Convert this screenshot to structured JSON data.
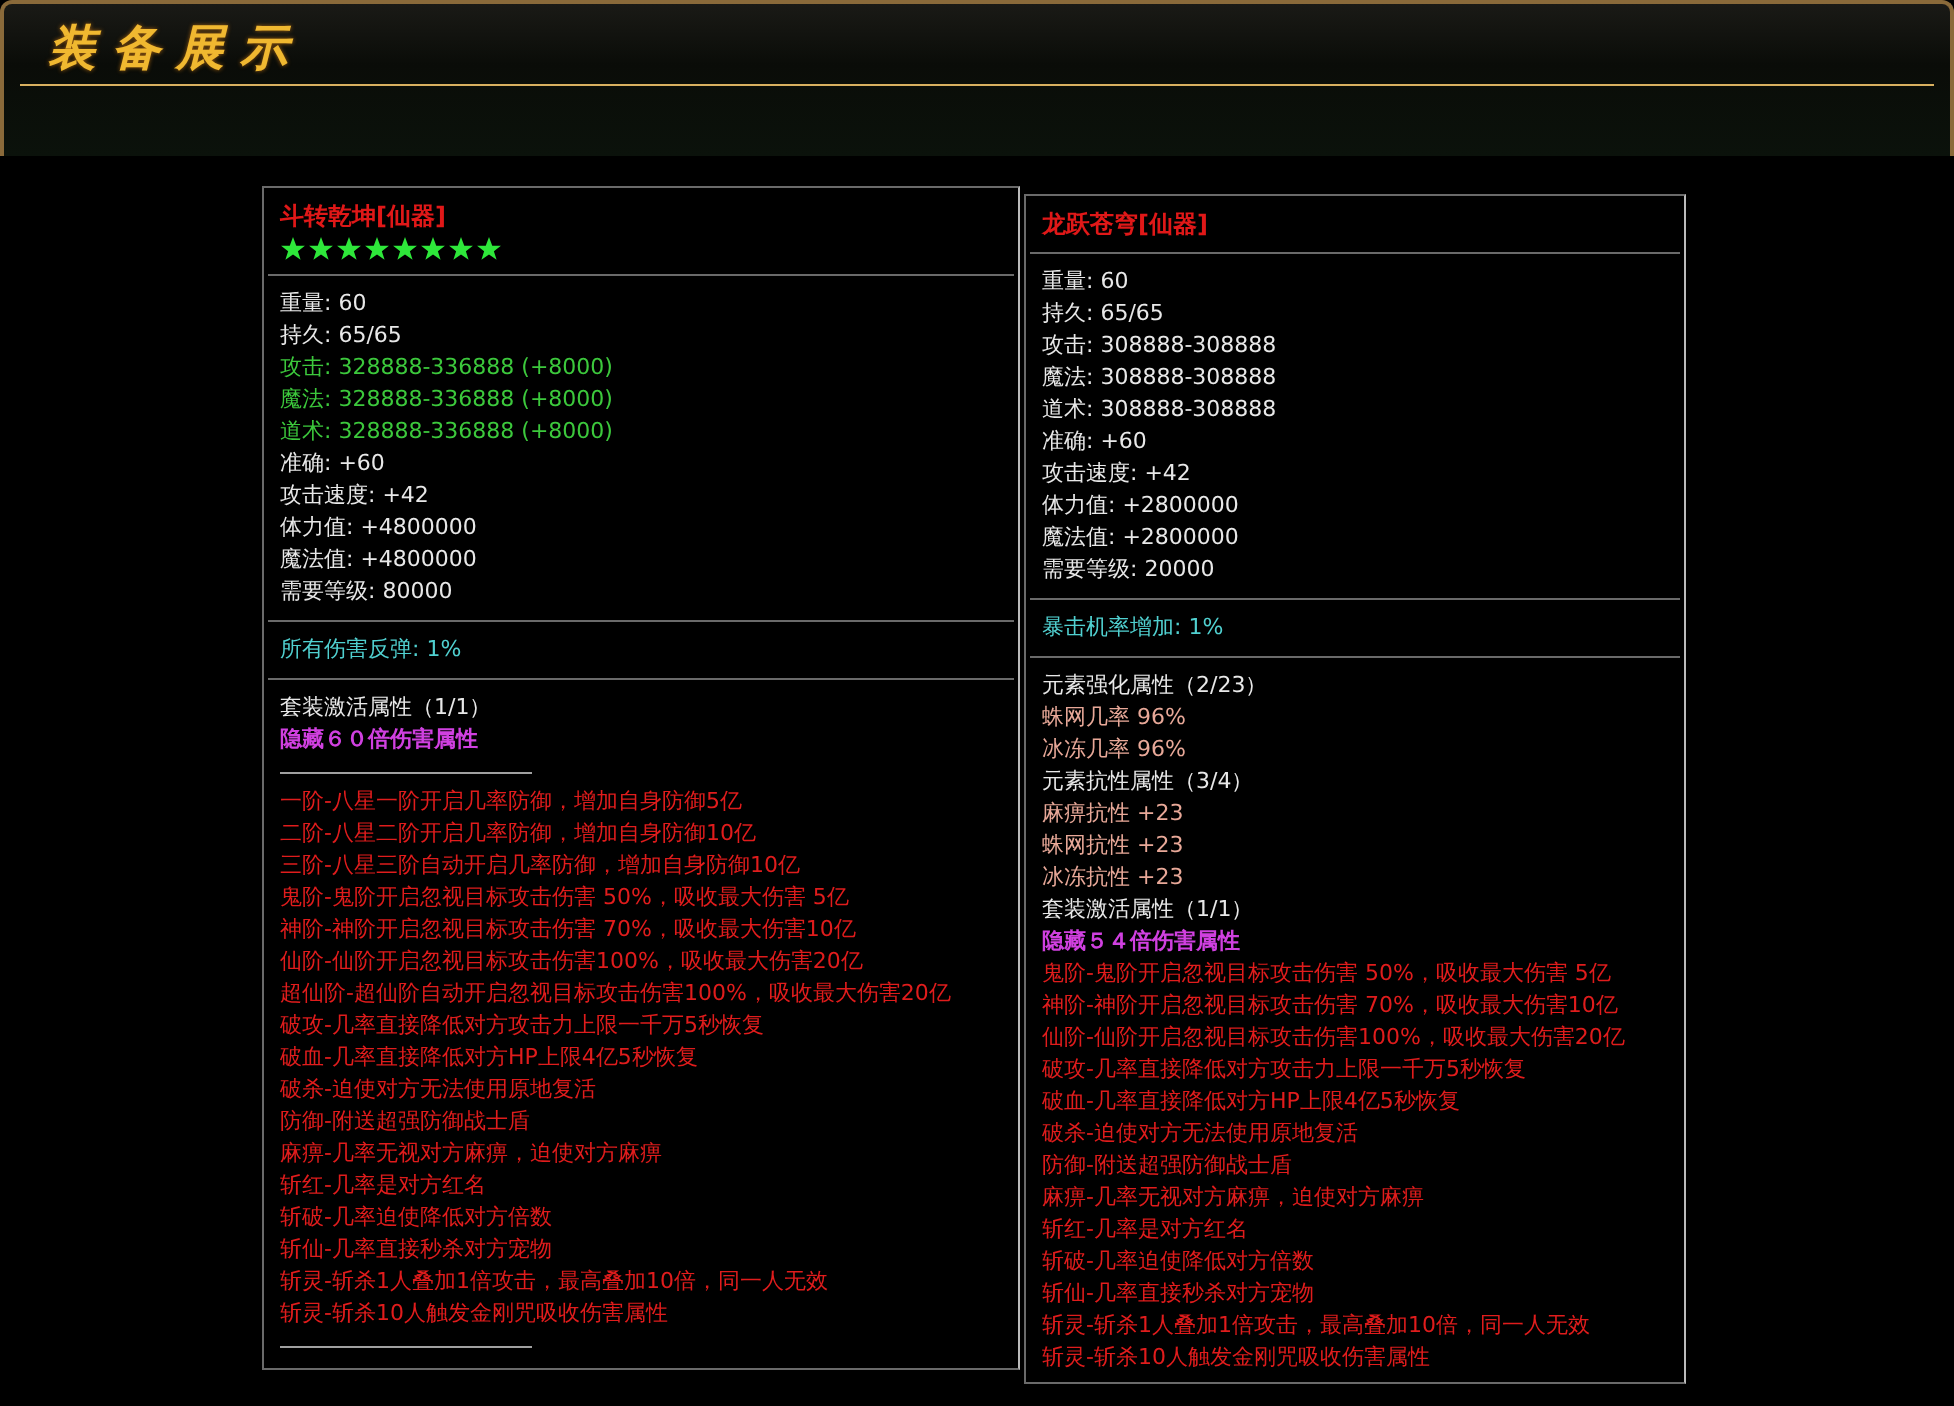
{
  "header": {
    "title": "装备展示"
  },
  "items": [
    {
      "name": "斗转乾坤[仙器]",
      "stars": 8,
      "sections": [
        [
          {
            "kind": "white",
            "text": "重量: 60"
          },
          {
            "kind": "white",
            "text": "持久: 65/65"
          },
          {
            "kind": "green",
            "text": "攻击: 328888-336888 (+8000)"
          },
          {
            "kind": "green",
            "text": "魔法: 328888-336888 (+8000)"
          },
          {
            "kind": "green",
            "text": "道术: 328888-336888 (+8000)"
          },
          {
            "kind": "white",
            "text": "准确: +60"
          },
          {
            "kind": "white",
            "text": "攻击速度: +42"
          },
          {
            "kind": "white",
            "text": "体力值: +4800000"
          },
          {
            "kind": "white",
            "text": "魔法值: +4800000"
          },
          {
            "kind": "white",
            "text": "需要等级: 80000"
          }
        ],
        [
          {
            "kind": "cyan",
            "text": "所有伤害反弹: 1%"
          }
        ],
        [
          {
            "kind": "white",
            "text": "套装激活属性（1/1）"
          },
          {
            "kind": "purple",
            "text": "隐藏６０倍伤害属性"
          },
          {
            "kind": "rule"
          },
          {
            "kind": "red",
            "text": "一阶-八星一阶开启几率防御，增加自身防御5亿"
          },
          {
            "kind": "red",
            "text": "二阶-八星二阶开启几率防御，增加自身防御10亿"
          },
          {
            "kind": "red",
            "text": "三阶-八星三阶自动开启几率防御，增加自身防御10亿"
          },
          {
            "kind": "red",
            "text": "鬼阶-鬼阶开启忽视目标攻击伤害 50%，吸收最大伤害 5亿"
          },
          {
            "kind": "red",
            "text": "神阶-神阶开启忽视目标攻击伤害 70%，吸收最大伤害10亿"
          },
          {
            "kind": "red",
            "text": "仙阶-仙阶开启忽视目标攻击伤害100%，吸收最大伤害20亿"
          },
          {
            "kind": "red",
            "text": "超仙阶-超仙阶自动开启忽视目标攻击伤害100%，吸收最大伤害20亿"
          },
          {
            "kind": "red",
            "text": "破攻-几率直接降低对方攻击力上限一千万5秒恢复"
          },
          {
            "kind": "red",
            "text": "破血-几率直接降低对方HP上限4亿5秒恢复"
          },
          {
            "kind": "red",
            "text": "破杀-迫使对方无法使用原地复活"
          },
          {
            "kind": "red",
            "text": "防御-附送超强防御战士盾"
          },
          {
            "kind": "red",
            "text": "麻痹-几率无视对方麻痹，迫使对方麻痹"
          },
          {
            "kind": "red",
            "text": "斩红-几率是对方红名"
          },
          {
            "kind": "red",
            "text": "斩破-几率迫使降低对方倍数"
          },
          {
            "kind": "red",
            "text": "斩仙-几率直接秒杀对方宠物"
          },
          {
            "kind": "red",
            "text": "斩灵-斩杀1人叠加1倍攻击，最高叠加10倍，同一人无效"
          },
          {
            "kind": "red",
            "text": "斩灵-斩杀10人触发金刚咒吸收伤害属性"
          },
          {
            "kind": "rule"
          }
        ]
      ]
    },
    {
      "name": "龙跃苍穹[仙器]",
      "sections": [
        [
          {
            "kind": "white",
            "text": "重量: 60"
          },
          {
            "kind": "white",
            "text": "持久: 65/65"
          },
          {
            "kind": "white",
            "text": "攻击: 308888-308888"
          },
          {
            "kind": "white",
            "text": "魔法: 308888-308888"
          },
          {
            "kind": "white",
            "text": "道术: 308888-308888"
          },
          {
            "kind": "white",
            "text": "准确: +60"
          },
          {
            "kind": "white",
            "text": "攻击速度: +42"
          },
          {
            "kind": "white",
            "text": "体力值: +2800000"
          },
          {
            "kind": "white",
            "text": "魔法值: +2800000"
          },
          {
            "kind": "white",
            "text": "需要等级: 20000"
          }
        ],
        [
          {
            "kind": "cyan",
            "text": "暴击机率增加: 1%"
          }
        ],
        [
          {
            "kind": "white",
            "text": "元素强化属性（2/23）"
          },
          {
            "kind": "pink",
            "text": "蛛网几率 96%"
          },
          {
            "kind": "pink",
            "text": "冰冻几率 96%"
          },
          {
            "kind": "white",
            "text": "元素抗性属性（3/4）"
          },
          {
            "kind": "pink",
            "text": "麻痹抗性 +23"
          },
          {
            "kind": "pink",
            "text": "蛛网抗性 +23"
          },
          {
            "kind": "pink",
            "text": "冰冻抗性 +23"
          },
          {
            "kind": "white",
            "text": "套装激活属性（1/1）"
          },
          {
            "kind": "purple",
            "text": "隐藏５４倍伤害属性"
          },
          {
            "kind": "red",
            "text": "鬼阶-鬼阶开启忽视目标攻击伤害 50%，吸收最大伤害 5亿"
          },
          {
            "kind": "red",
            "text": "神阶-神阶开启忽视目标攻击伤害 70%，吸收最大伤害10亿"
          },
          {
            "kind": "red",
            "text": "仙阶-仙阶开启忽视目标攻击伤害100%，吸收最大伤害20亿"
          },
          {
            "kind": "red",
            "text": "破攻-几率直接降低对方攻击力上限一千万5秒恢复"
          },
          {
            "kind": "red",
            "text": "破血-几率直接降低对方HP上限4亿5秒恢复"
          },
          {
            "kind": "red",
            "text": "破杀-迫使对方无法使用原地复活"
          },
          {
            "kind": "red",
            "text": "防御-附送超强防御战士盾"
          },
          {
            "kind": "red",
            "text": "麻痹-几率无视对方麻痹，迫使对方麻痹"
          },
          {
            "kind": "red",
            "text": "斩红-几率是对方红名"
          },
          {
            "kind": "red",
            "text": "斩破-几率迫使降低对方倍数"
          },
          {
            "kind": "red",
            "text": "斩仙-几率直接秒杀对方宠物"
          },
          {
            "kind": "red",
            "text": "斩灵-斩杀1人叠加1倍攻击，最高叠加10倍，同一人无效"
          },
          {
            "kind": "red",
            "text": "斩灵-斩杀10人触发金刚咒吸收伤害属性"
          }
        ]
      ]
    }
  ]
}
